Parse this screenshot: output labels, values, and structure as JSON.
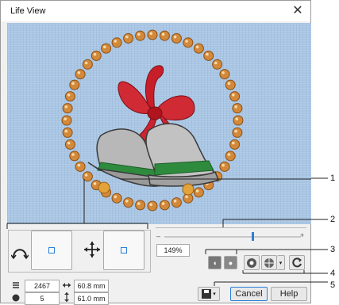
{
  "dialog": {
    "title": "Life View"
  },
  "view_controls": {
    "zoom": "149%",
    "zoom_minus": "–",
    "zoom_plus": "+"
  },
  "info": {
    "stitches": "2467",
    "colors": "5",
    "width": "60.8 mm",
    "height": "61.0 mm"
  },
  "buttons": {
    "cancel": "Cancel",
    "help": "Help"
  },
  "callouts": [
    "1",
    "2",
    "3",
    "4",
    "5"
  ],
  "colors": {
    "fabric": "#a9c6e4",
    "accent": "#2d7fd7"
  },
  "icons": [
    "close-icon",
    "curve-tool-icon",
    "move-tool-icon",
    "light-icon",
    "dark-icon",
    "stitch-icon",
    "color-wheel-icon",
    "rotate-icon",
    "save-icon",
    "dropdown-arrow-icon",
    "stitches-icon",
    "palette-icon",
    "width-icon",
    "height-icon"
  ]
}
